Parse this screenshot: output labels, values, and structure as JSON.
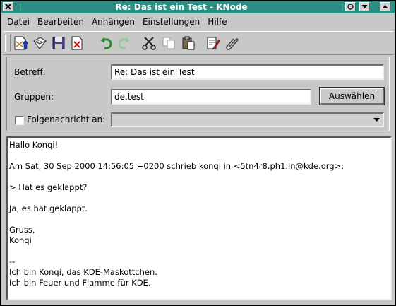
{
  "window": {
    "title": "Re: Das ist ein Test - KNode",
    "buttons": [
      "close-icon",
      "sticky-icon",
      "minimize-icon",
      "maximize-icon"
    ]
  },
  "menu": [
    {
      "label": "Datei"
    },
    {
      "label": "Bearbeiten"
    },
    {
      "label": "Anhängen"
    },
    {
      "label": "Einstellungen"
    },
    {
      "label": "Hilfe"
    }
  ],
  "toolbar": [
    {
      "name": "send-now-icon"
    },
    {
      "name": "send-later-icon"
    },
    {
      "name": "save-icon"
    },
    {
      "name": "delete-icon"
    },
    {
      "name": "undo-icon"
    },
    {
      "name": "redo-icon"
    },
    {
      "name": "cut-icon"
    },
    {
      "name": "copy-icon"
    },
    {
      "name": "paste-icon"
    },
    {
      "name": "spellcheck-icon"
    },
    {
      "name": "attach-icon"
    }
  ],
  "form": {
    "subject_label": "Betreff:",
    "subject_value": "Re: Das ist ein Test",
    "groups_label": "Gruppen:",
    "groups_value": "de.test",
    "choose_button": "Auswählen",
    "followup_label": "Folgenachricht an:",
    "followup_checked": false,
    "followup_value": ""
  },
  "body": {
    "text": "Hallo Konqi!\n\nAm Sat, 30 Sep 2000 14:56:05 +0200 schrieb konqi in <5tn4r8.ph1.ln@kde.org>:\n\n> Hat es geklappt?\n\nJa, es hat geklappt.\n\nGruss,\nKonqi\n\n-- \nIch bin Konqi, das KDE-Maskottchen.\nIch bin Feuer und Flamme für KDE."
  },
  "colors": {
    "titlebar": "#2b8f86",
    "window_bg": "#c8c8c8"
  }
}
